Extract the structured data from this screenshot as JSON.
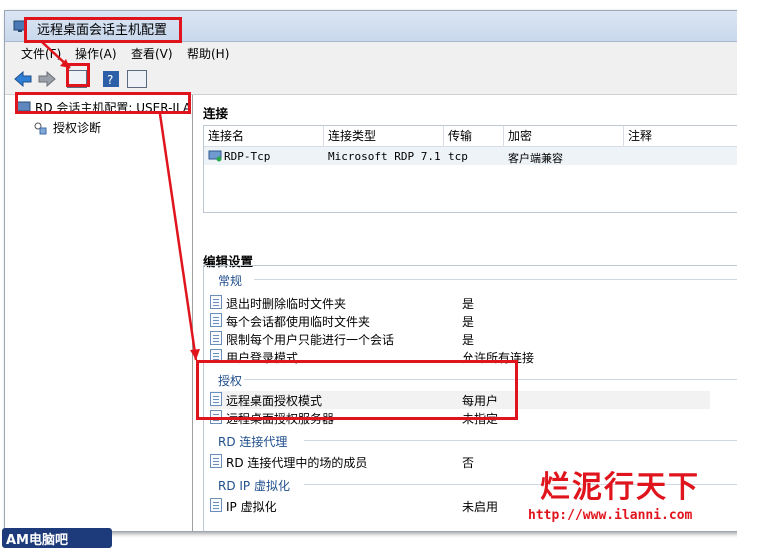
{
  "window": {
    "title": "远程桌面会话主机配置"
  },
  "menu": [
    "文件(F)",
    "操作(A)",
    "查看(V)",
    "帮助(H)"
  ],
  "toolbar": {
    "icons": [
      "back-arrow-icon",
      "forward-arrow-icon",
      "show-hide-tree-icon",
      "help-icon",
      "show-hide-action-pane-icon"
    ]
  },
  "tree": {
    "root": "RD 会话主机配置: USER-ILA",
    "child": "授权诊断"
  },
  "connections": {
    "title": "连接",
    "columns": [
      "连接名",
      "连接类型",
      "传输",
      "加密",
      "注释"
    ],
    "rows": [
      {
        "name": "RDP-Tcp",
        "type": "Microsoft RDP 7.1",
        "transport": "tcp",
        "encryption": "客户端兼容",
        "comment": ""
      }
    ]
  },
  "edit": {
    "title": "编辑设置",
    "groups": [
      {
        "name": "常规",
        "items": [
          {
            "label": "退出时删除临时文件夹",
            "value": "是"
          },
          {
            "label": "每个会话都使用临时文件夹",
            "value": "是"
          },
          {
            "label": "限制每个用户只能进行一个会话",
            "value": "是"
          },
          {
            "label": "用户登录模式",
            "value": "允许所有连接"
          }
        ]
      },
      {
        "name": "授权",
        "items": [
          {
            "label": "远程桌面授权模式",
            "value": "每用户"
          },
          {
            "label": "远程桌面授权服务器",
            "value": "未指定"
          }
        ]
      },
      {
        "name": "RD 连接代理",
        "items": [
          {
            "label": "RD 连接代理中的场的成员",
            "value": "否"
          }
        ]
      },
      {
        "name": "RD IP 虚拟化",
        "items": [
          {
            "label": "IP 虚拟化",
            "value": "未启用"
          }
        ]
      }
    ]
  },
  "watermark": {
    "brand": "烂泥行天下",
    "url": "http://www.ilanni.com",
    "logo": "AM电脑吧"
  },
  "colors": {
    "highlight_red": "#e0141c",
    "group_blue": "#1f4e8c"
  }
}
